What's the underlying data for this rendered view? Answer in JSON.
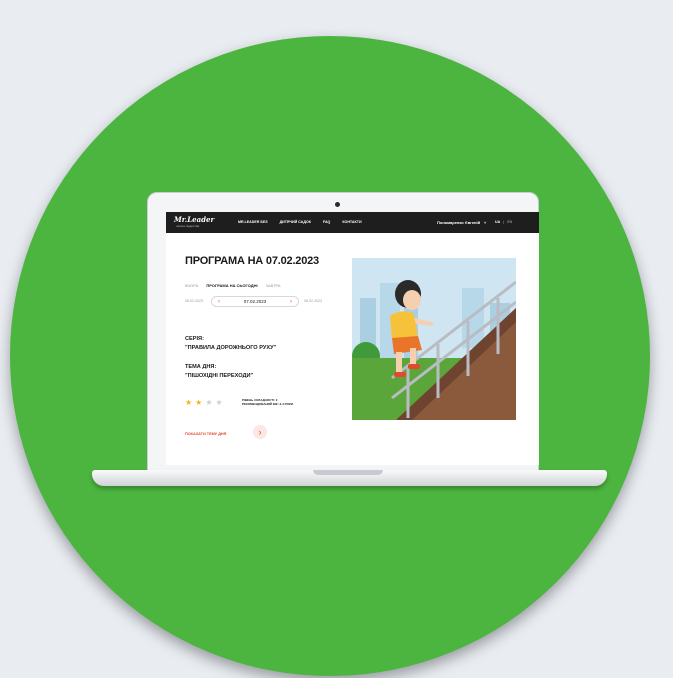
{
  "site": {
    "logo": "Mr.Leader",
    "logo_tagline": "школа лідерства",
    "nav_links": [
      "MR.LEADER БЕЗ",
      "ДИТЯЧИЙ САДОК",
      "FAQ",
      "КОНТАКТИ"
    ],
    "user_name": "Пономаренко Євгеній",
    "user_chevron": "˅",
    "languages": [
      "UA",
      "EN"
    ]
  },
  "program": {
    "title": "ПРОГРАМА НА 07.02.2023",
    "days": [
      "ВЧОРА",
      "ПРОГРАМА НА СЬОГОДНІ",
      "ЗАВТРА"
    ],
    "date_prev": "06.02.2023",
    "date_current": "07.02.2023",
    "date_next": "08.02.2023",
    "series_label": "СЕРІЯ:",
    "series_value": "\"ПРАВИЛА ДОРОЖНЬОГО РУХУ\"",
    "topic_label": "ТЕМА ДНЯ:",
    "topic_value": "\"ПІШОХІДНІ ПЕРЕХОДИ\"",
    "rating": 2,
    "rating_max": 4,
    "difficulty": "РІВЕНЬ СКЛАДНОСТІ: 2",
    "age": "РЕКОМЕНДОВАНИЙ ВІК: 3-4 РОКИ",
    "cta_label": "ПОКАЗАТИ ТЕМУ ДНЯ",
    "cta_arrow": "›"
  },
  "colors": {
    "background_circle": "#4bb53f",
    "accent": "#e24a2e",
    "star_on": "#f2b51c"
  }
}
